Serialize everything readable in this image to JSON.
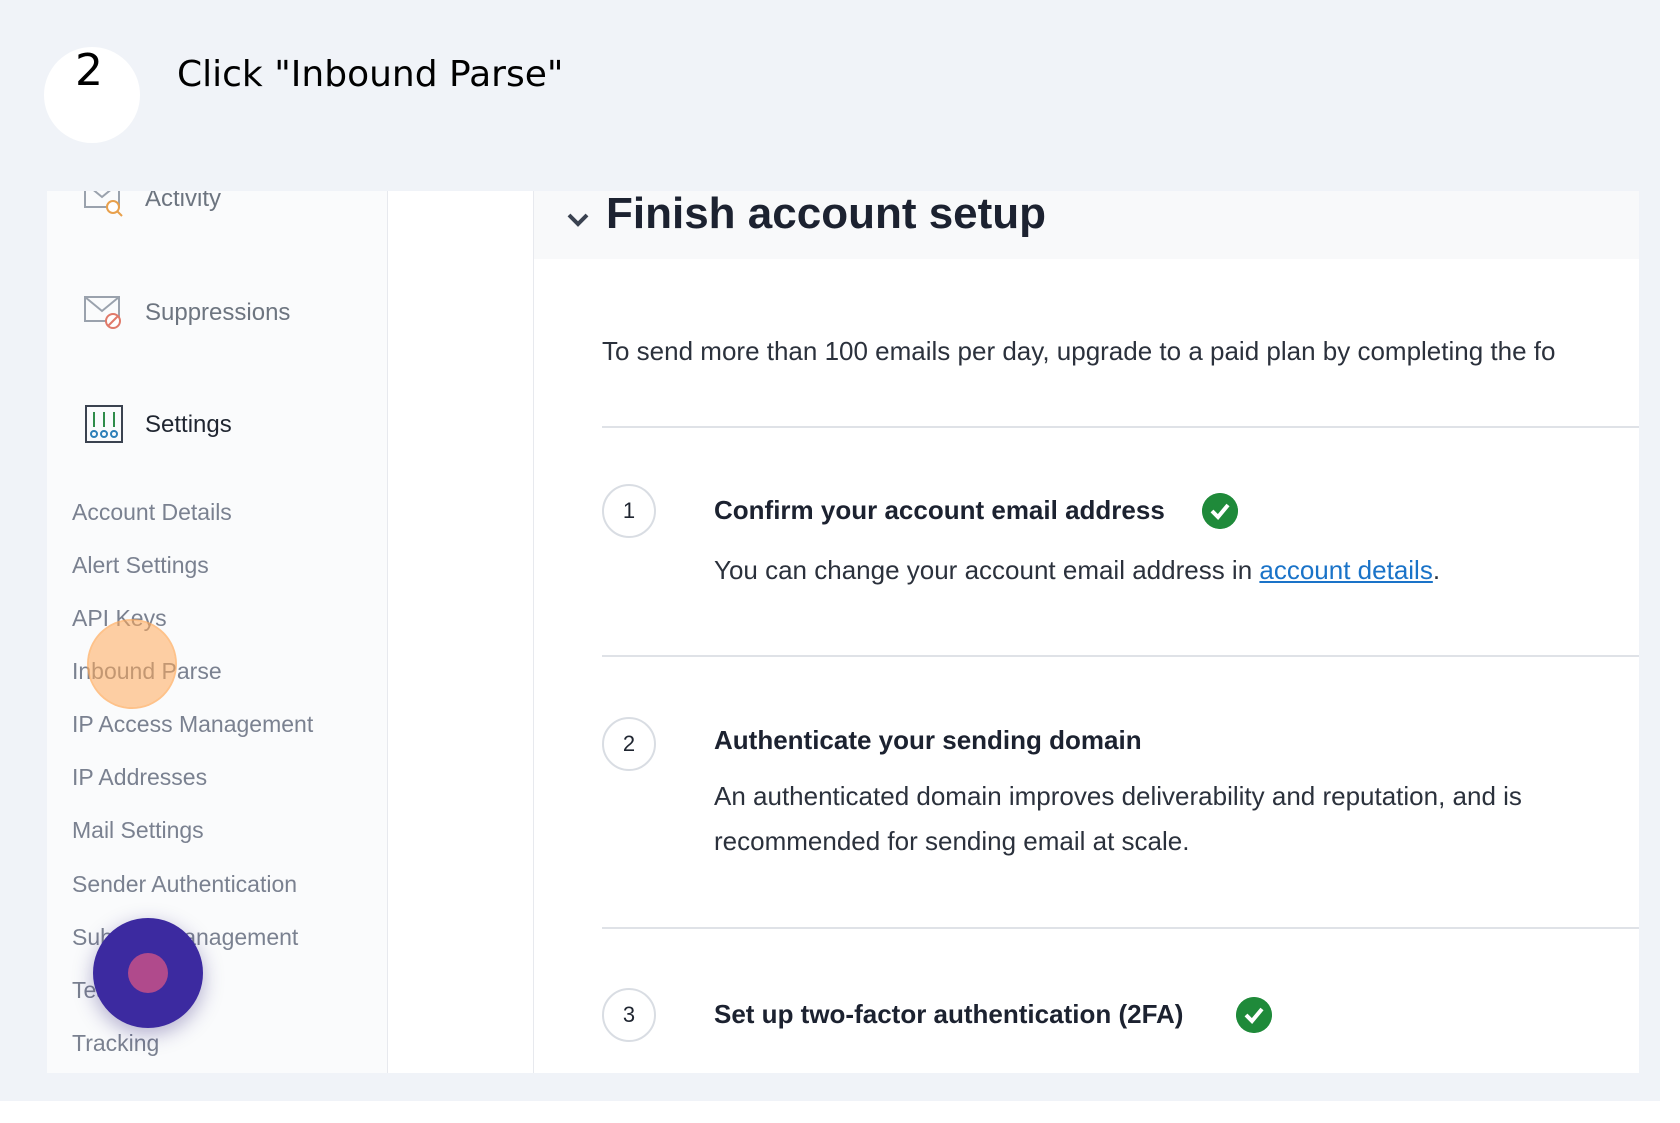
{
  "tutorial": {
    "step_number": "2",
    "instruction": "Click \"Inbound Parse\""
  },
  "sidebar": {
    "items": [
      {
        "label": "Activity",
        "icon": "mail-search-icon"
      },
      {
        "label": "Suppressions",
        "icon": "mail-block-icon"
      },
      {
        "label": "Settings",
        "icon": "sliders-icon"
      }
    ],
    "settings_subitems": [
      "Account Details",
      "Alert Settings",
      "API Keys",
      "Inbound Parse",
      "IP Access Management",
      "IP Addresses",
      "Mail Settings",
      "Sender Authentication",
      "Subuser Management",
      "Teammates",
      "Tracking"
    ]
  },
  "main": {
    "title": "Finish account setup",
    "intro": "To send more than 100 emails per day, upgrade to a paid plan by completing the fo",
    "tasks": [
      {
        "number": "1",
        "title": "Confirm your account email address",
        "completed": true,
        "body_prefix": "You can change your account email address in ",
        "body_link": "account details",
        "body_suffix": "."
      },
      {
        "number": "2",
        "title": "Authenticate your sending domain",
        "completed": false,
        "body_line1": "An authenticated domain improves deliverability and reputation, and is",
        "body_line2": "recommended for sending email at scale."
      },
      {
        "number": "3",
        "title": "Set up two-factor authentication (2FA)",
        "completed": true
      }
    ]
  },
  "colors": {
    "check_green": "#1f8a3a",
    "link_blue": "#1a73c8",
    "click_highlight": "#ffaa5a",
    "record_button": "#3c2aa0"
  }
}
